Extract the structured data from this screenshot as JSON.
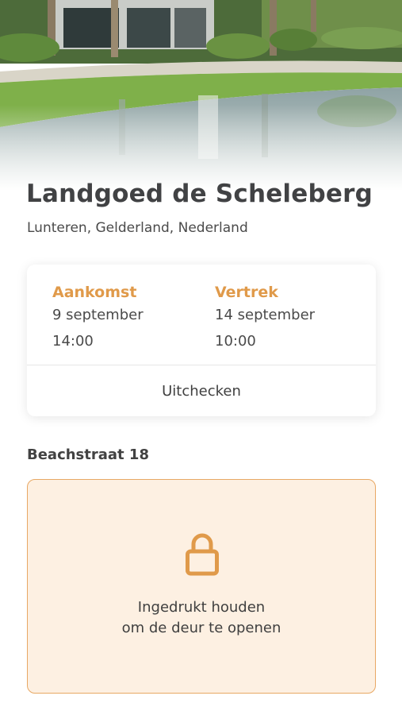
{
  "property": {
    "name": "Landgoed de Scheleberg",
    "location": "Lunteren, Gelderland, Nederland"
  },
  "stay": {
    "arrival_label": "Aankomst",
    "arrival_date": "9 september",
    "arrival_time": "14:00",
    "departure_label": "Vertrek",
    "departure_date": "14 september",
    "departure_time": "10:00",
    "checkout_label": "Uitchecken"
  },
  "room": {
    "address": "Beachstraat 18"
  },
  "door": {
    "icon": "lock-icon",
    "instruction_line1": "Ingedrukt houden",
    "instruction_line2": "om de deur te openen"
  },
  "colors": {
    "accent": "#e09a4a",
    "panel_background": "#fdf0e2",
    "panel_border": "#e8a864"
  }
}
